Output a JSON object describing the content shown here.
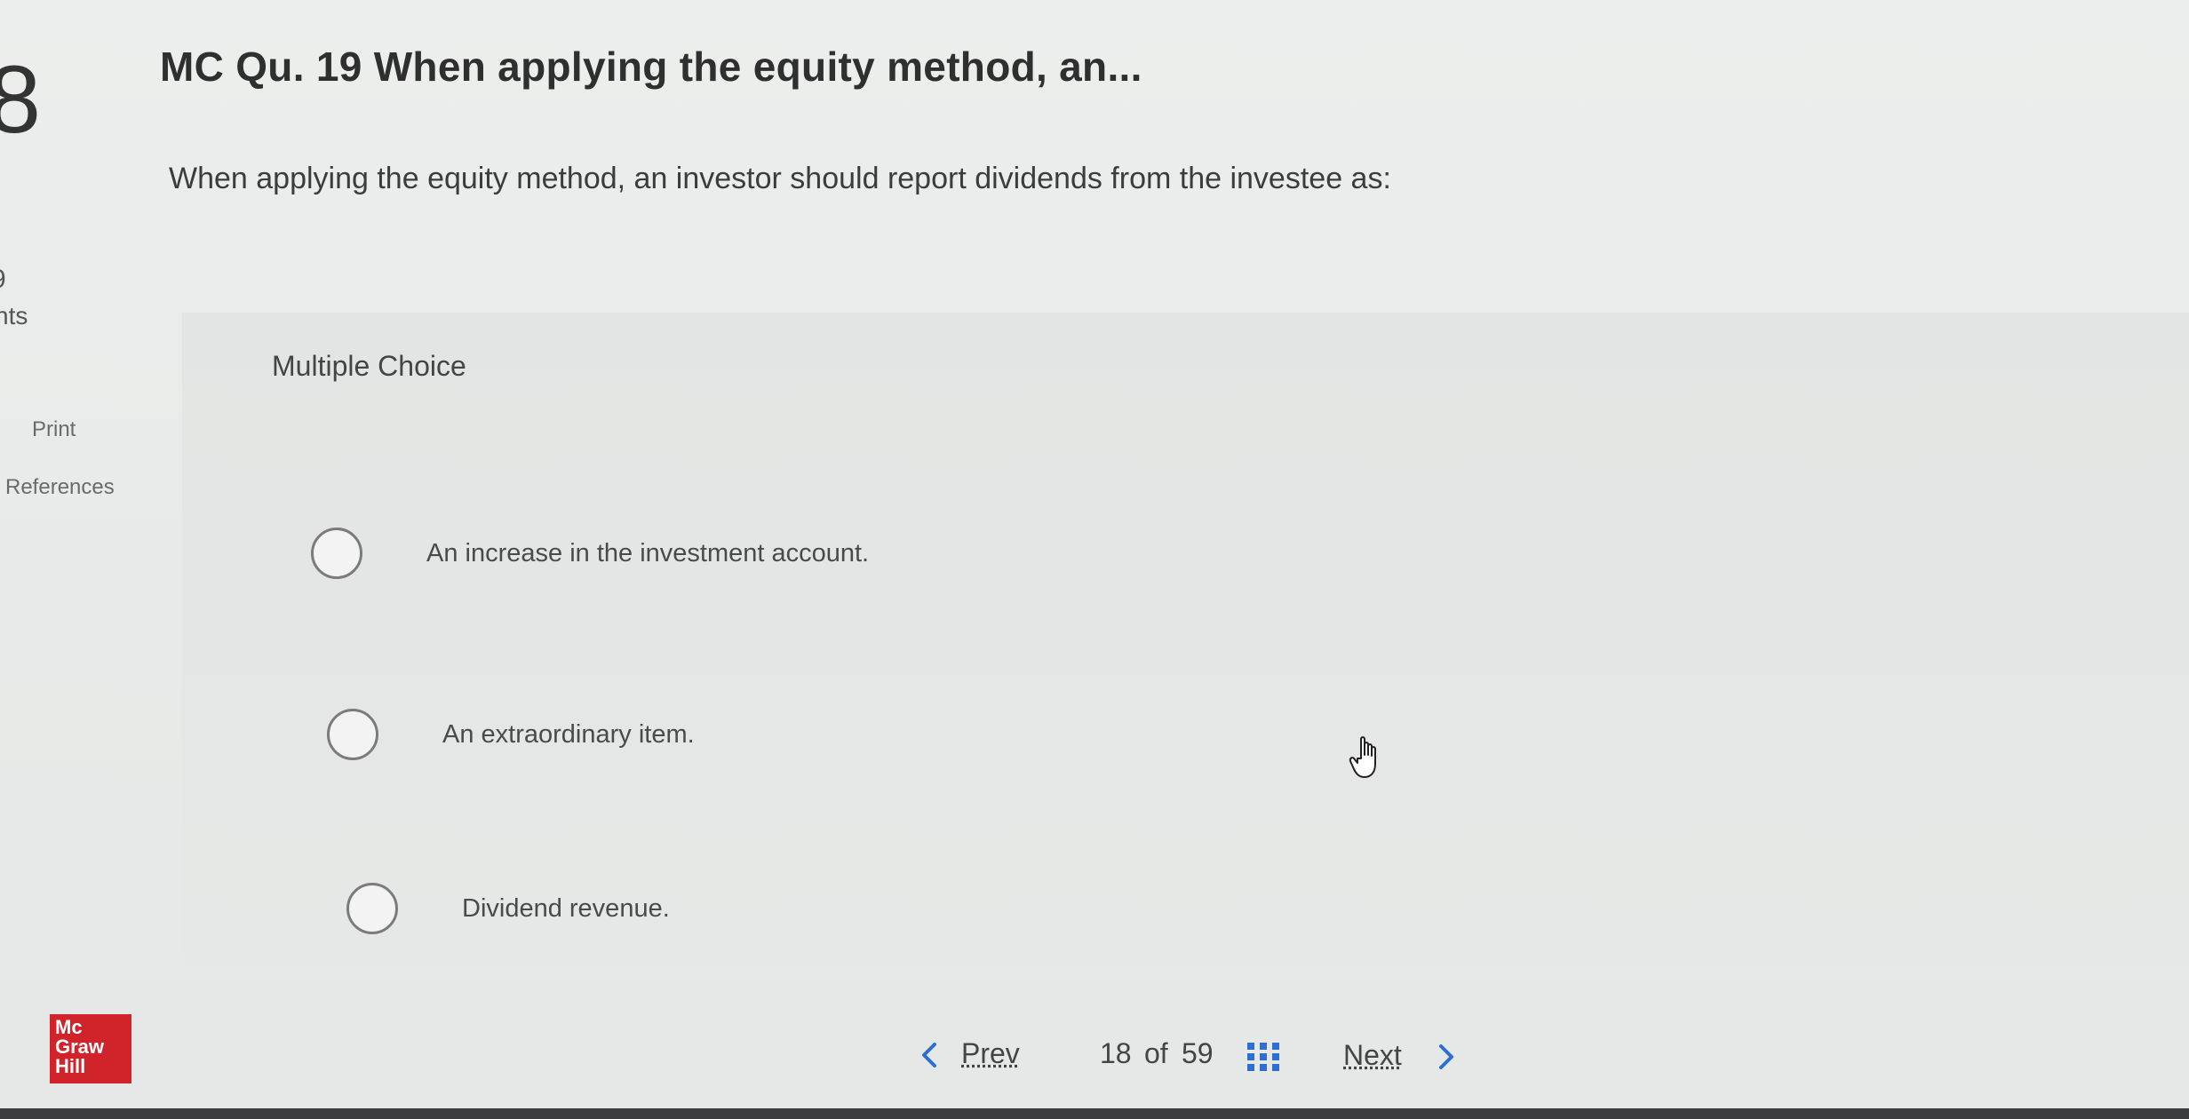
{
  "left_rail": {
    "question_number": "8",
    "points_value": "9",
    "points_label": "nts",
    "print_label": "Print",
    "references_label": "References"
  },
  "question": {
    "title": "MC Qu. 19 When applying the equity method, an...",
    "prompt": "When applying the equity method, an investor should report dividends from the investee as:",
    "type_label": "Multiple Choice",
    "options": [
      {
        "label": "An increase in the investment account."
      },
      {
        "label": "An extraordinary item."
      },
      {
        "label": "Dividend revenue."
      }
    ]
  },
  "pagination": {
    "prev_label": "Prev",
    "current": "18",
    "of_label": "of",
    "total": "59",
    "next_label": "Next"
  },
  "logo": {
    "line1": "Mc",
    "line2": "Graw",
    "line3": "Hill"
  },
  "colors": {
    "logo_red": "#d1232a",
    "accent_blue": "#1f6fd1"
  }
}
